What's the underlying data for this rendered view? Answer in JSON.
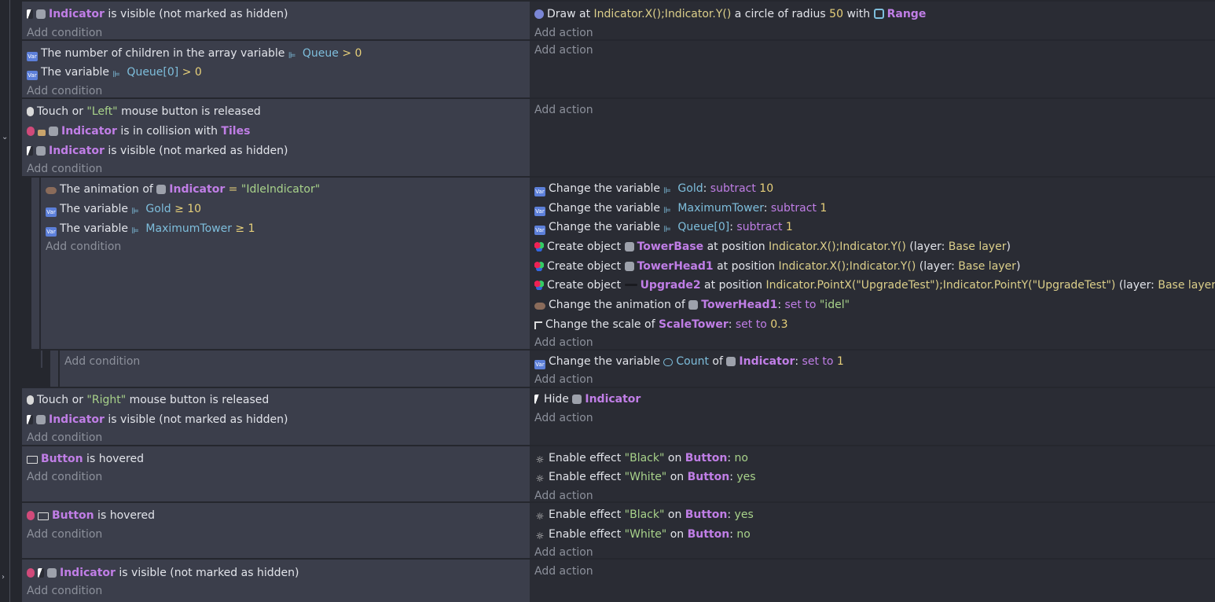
{
  "events": [
    {
      "conditions": [
        {
          "icons": [
            "eye-icon",
            "object-icon"
          ],
          "parts": [
            [
              "obj",
              "Indicator"
            ],
            [
              "t",
              " is visible (not marked as hidden)"
            ]
          ]
        }
      ],
      "actions": [
        {
          "icons": [
            "draw-icon"
          ],
          "parts": [
            [
              "t",
              "Draw at "
            ],
            [
              "expr",
              "Indicator.X();Indicator.Y()"
            ],
            [
              "t",
              " a circle of radius "
            ],
            [
              "num",
              "50"
            ],
            [
              "t",
              " with "
            ],
            [
              "icon",
              "range-icon"
            ],
            [
              "obj",
              "Range"
            ]
          ]
        }
      ]
    },
    {
      "conditions": [
        {
          "icons": [
            "variable-icon"
          ],
          "parts": [
            [
              "t",
              "The number of children in the array variable "
            ],
            [
              "icon",
              "var-ref-icon"
            ],
            [
              "var",
              "Queue"
            ],
            [
              "op",
              "  >  0"
            ]
          ]
        },
        {
          "icons": [
            "variable-icon"
          ],
          "parts": [
            [
              "t",
              "The variable "
            ],
            [
              "icon",
              "var-ref-icon"
            ],
            [
              "var",
              "Queue[0]"
            ],
            [
              "op",
              "  >  0"
            ]
          ]
        }
      ],
      "actions": []
    },
    {
      "conditions": [
        {
          "icons": [
            "mouse-icon"
          ],
          "parts": [
            [
              "t",
              "Touch or "
            ],
            [
              "str",
              "\"Left\""
            ],
            [
              "t",
              " mouse button is released"
            ]
          ]
        },
        {
          "icons": [
            "invert-icon",
            "collision-icon",
            "object-icon"
          ],
          "parts": [
            [
              "obj",
              "Indicator"
            ],
            [
              "t",
              " is in collision with "
            ],
            [
              "obj",
              "Tiles"
            ]
          ]
        },
        {
          "icons": [
            "eye-icon",
            "object-icon"
          ],
          "parts": [
            [
              "obj",
              "Indicator"
            ],
            [
              "t",
              " is visible (not marked as hidden)"
            ]
          ]
        }
      ],
      "actions": []
    },
    {
      "conditions": [
        {
          "icons": [
            "animation-icon"
          ],
          "parts": [
            [
              "t",
              "The animation of "
            ],
            [
              "icon",
              "object-icon"
            ],
            [
              "obj",
              "Indicator"
            ],
            [
              "op",
              " = "
            ],
            [
              "str",
              " \"IdleIndicator\""
            ]
          ]
        },
        {
          "icons": [
            "variable-icon"
          ],
          "parts": [
            [
              "t",
              "The variable "
            ],
            [
              "icon",
              "var-ref-icon"
            ],
            [
              "var",
              "Gold"
            ],
            [
              "op",
              "  ≥  10"
            ]
          ]
        },
        {
          "icons": [
            "variable-icon"
          ],
          "parts": [
            [
              "t",
              "The variable "
            ],
            [
              "icon",
              "var-ref-icon"
            ],
            [
              "var",
              "MaximumTower"
            ],
            [
              "op",
              "  ≥  1"
            ]
          ]
        }
      ],
      "actions": [
        {
          "icons": [
            "variable-icon"
          ],
          "parts": [
            [
              "t",
              "Change the variable "
            ],
            [
              "icon",
              "var-ref-icon"
            ],
            [
              "var",
              "Gold"
            ],
            [
              "t",
              ": "
            ],
            [
              "kw",
              "subtract "
            ],
            [
              "num",
              "10"
            ]
          ]
        },
        {
          "icons": [
            "variable-icon"
          ],
          "parts": [
            [
              "t",
              "Change the variable "
            ],
            [
              "icon",
              "var-ref-icon"
            ],
            [
              "var",
              "MaximumTower"
            ],
            [
              "t",
              ": "
            ],
            [
              "kw",
              "subtract "
            ],
            [
              "num",
              "1"
            ]
          ]
        },
        {
          "icons": [
            "variable-icon"
          ],
          "parts": [
            [
              "t",
              "Change the variable "
            ],
            [
              "icon",
              "var-ref-icon"
            ],
            [
              "var",
              "Queue[0]"
            ],
            [
              "t",
              ": "
            ],
            [
              "kw",
              "subtract "
            ],
            [
              "num",
              "1"
            ]
          ]
        },
        {
          "icons": [
            "create-icon"
          ],
          "parts": [
            [
              "t",
              "Create object "
            ],
            [
              "icon",
              "object-icon"
            ],
            [
              "obj",
              "TowerBase"
            ],
            [
              "t",
              "  at position "
            ],
            [
              "expr",
              "Indicator.X();Indicator.Y()"
            ],
            [
              "t",
              " (layer: "
            ],
            [
              "expr",
              "Base layer"
            ],
            [
              "t",
              ")"
            ]
          ]
        },
        {
          "icons": [
            "create-icon"
          ],
          "parts": [
            [
              "t",
              "Create object "
            ],
            [
              "icon",
              "object-icon"
            ],
            [
              "obj",
              "TowerHead1"
            ],
            [
              "t",
              "  at position "
            ],
            [
              "expr",
              "Indicator.X();Indicator.Y()"
            ],
            [
              "t",
              " (layer: "
            ],
            [
              "expr",
              "Base layer"
            ],
            [
              "t",
              ")"
            ]
          ]
        },
        {
          "icons": [
            "create-icon"
          ],
          "parts": [
            [
              "t",
              "Create object "
            ],
            [
              "icon",
              "blank-icon"
            ],
            [
              "obj",
              "Upgrade2"
            ],
            [
              "t",
              " at position "
            ],
            [
              "expr",
              "Indicator.PointX(\"UpgradeTest\");Indicator.PointY(\"UpgradeTest\")"
            ],
            [
              "t",
              " (layer: "
            ],
            [
              "expr",
              "Base layer"
            ],
            [
              "t",
              ")"
            ]
          ]
        },
        {
          "icons": [
            "animation-icon"
          ],
          "parts": [
            [
              "t",
              "Change the animation of "
            ],
            [
              "icon",
              "object-icon"
            ],
            [
              "obj",
              "TowerHead1"
            ],
            [
              "t",
              ": "
            ],
            [
              "kw",
              "set to "
            ],
            [
              "str",
              " \"idel\""
            ]
          ]
        },
        {
          "icons": [
            "scale-icon"
          ],
          "parts": [
            [
              "t",
              "Change the scale of "
            ],
            [
              "obj",
              "ScaleTower"
            ],
            [
              "t",
              ": "
            ],
            [
              "kw",
              "set to "
            ],
            [
              "num",
              " 0.3"
            ]
          ]
        }
      ]
    },
    {
      "conditions": [],
      "actions": [
        {
          "icons": [
            "variable-icon"
          ],
          "parts": [
            [
              "t",
              "Change the variable "
            ],
            [
              "icon",
              "count-icon"
            ],
            [
              "var",
              "Count"
            ],
            [
              "t",
              " of "
            ],
            [
              "icon",
              "object-icon"
            ],
            [
              "obj",
              "Indicator"
            ],
            [
              "t",
              ": "
            ],
            [
              "kw",
              "set to "
            ],
            [
              "num",
              "1"
            ]
          ]
        }
      ]
    },
    {
      "conditions": [
        {
          "icons": [
            "mouse-icon"
          ],
          "parts": [
            [
              "t",
              "Touch or "
            ],
            [
              "str",
              "\"Right\""
            ],
            [
              "t",
              " mouse button is released"
            ]
          ]
        },
        {
          "icons": [
            "eye-icon",
            "object-icon"
          ],
          "parts": [
            [
              "obj",
              "Indicator"
            ],
            [
              "t",
              " is visible (not marked as hidden)"
            ]
          ]
        }
      ],
      "actions": [
        {
          "icons": [
            "eye-icon"
          ],
          "parts": [
            [
              "t",
              "Hide "
            ],
            [
              "icon",
              "object-icon"
            ],
            [
              "obj",
              "Indicator"
            ]
          ]
        }
      ]
    },
    {
      "conditions": [
        {
          "icons": [
            "button-icon"
          ],
          "parts": [
            [
              "obj",
              "Button"
            ],
            [
              "t",
              " is hovered"
            ]
          ]
        }
      ],
      "actions": [
        {
          "icons": [
            "effect-icon"
          ],
          "parts": [
            [
              "t",
              "Enable effect "
            ],
            [
              "str",
              "\"Black\""
            ],
            [
              "t",
              " on "
            ],
            [
              "obj",
              "Button"
            ],
            [
              "t",
              ": "
            ],
            [
              "str",
              "no"
            ]
          ]
        },
        {
          "icons": [
            "effect-icon"
          ],
          "parts": [
            [
              "t",
              "Enable effect "
            ],
            [
              "str",
              "\"White\""
            ],
            [
              "t",
              " on "
            ],
            [
              "obj",
              "Button"
            ],
            [
              "t",
              ": "
            ],
            [
              "str",
              "yes"
            ]
          ]
        }
      ]
    },
    {
      "conditions": [
        {
          "icons": [
            "invert-icon",
            "button-icon"
          ],
          "parts": [
            [
              "obj",
              "Button"
            ],
            [
              "t",
              " is hovered"
            ]
          ]
        }
      ],
      "actions": [
        {
          "icons": [
            "effect-icon"
          ],
          "parts": [
            [
              "t",
              "Enable effect "
            ],
            [
              "str",
              "\"Black\""
            ],
            [
              "t",
              " on "
            ],
            [
              "obj",
              "Button"
            ],
            [
              "t",
              ": "
            ],
            [
              "str",
              "yes"
            ]
          ]
        },
        {
          "icons": [
            "effect-icon"
          ],
          "parts": [
            [
              "t",
              "Enable effect "
            ],
            [
              "str",
              "\"White\""
            ],
            [
              "t",
              " on "
            ],
            [
              "obj",
              "Button"
            ],
            [
              "t",
              ": "
            ],
            [
              "str",
              "no"
            ]
          ]
        }
      ]
    },
    {
      "conditions": [
        {
          "icons": [
            "invert-icon",
            "eye-icon",
            "object-icon"
          ],
          "parts": [
            [
              "obj",
              "Indicator"
            ],
            [
              "t",
              " is visible (not marked as hidden)"
            ]
          ]
        }
      ],
      "actions": []
    }
  ],
  "labels": {
    "add_condition": "Add condition",
    "add_action": "Add action"
  }
}
